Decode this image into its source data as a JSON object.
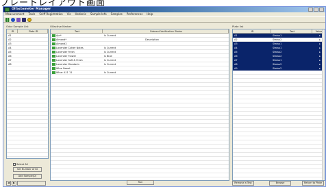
{
  "caption": "プレートレイアウト画面",
  "window": {
    "title": "Olfactometer Manager",
    "menus": [
      "Measurement",
      "Tools",
      "Sniff Registration",
      "Vis",
      "Hedonic",
      "Sample Info",
      "Samples",
      "Preferences",
      "Help"
    ]
  },
  "left_panel": {
    "label": "Odor Sample List",
    "columns": [
      "ID",
      "Plate ID"
    ],
    "rows": [
      [
        "A1",
        ""
      ],
      [
        "A2",
        ""
      ],
      [
        "A3",
        ""
      ],
      [
        "A4",
        ""
      ],
      [
        "A5",
        ""
      ],
      [
        "A6",
        ""
      ],
      [
        "A7",
        ""
      ],
      [
        "A8",
        ""
      ]
    ],
    "checkbox_label": "Select All",
    "btn_set_numbers": "Set Number of ID",
    "btn_add_sample": "Add Sample(D)"
  },
  "middle_panel": {
    "label": "Olfactive Marker",
    "columns": [
      "Test",
      "Odorant Verification Status"
    ],
    "rows": [
      {
        "name": "Apr*",
        "v1": "Is Current",
        "v2": ""
      },
      {
        "name": "Almond*",
        "v1": "",
        "v2": "Description"
      },
      {
        "name": "Almond2",
        "v1": "",
        "v2": ""
      },
      {
        "name": "Lavender Cutter Notes",
        "v1": "Is Current",
        "v2": ""
      },
      {
        "name": "Lavender Fresh",
        "v1": "Is Current",
        "v2": ""
      },
      {
        "name": "Lavender Flower",
        "v1": "Is Blue",
        "v2": ""
      },
      {
        "name": "Lavender Soft & Fresh",
        "v1": "Is Current",
        "v2": ""
      },
      {
        "name": "Lavender Mandarin",
        "v1": "Is Current",
        "v2": ""
      },
      {
        "name": "Wine Sweet",
        "v1": "",
        "v2": ""
      },
      {
        "name": "Wine: A11 11",
        "v1": "Is Current",
        "v2": ""
      }
    ]
  },
  "right_panel": {
    "label": "Plate list",
    "columns": [
      "ID",
      "Test",
      "Value"
    ],
    "rows": [
      {
        "id": "A1",
        "test": "Status1",
        "sel": true
      },
      {
        "id": "A2",
        "test": "Status2",
        "sel": false
      },
      {
        "id": "A3",
        "test": "Status1",
        "sel": true
      },
      {
        "id": "A4",
        "test": "Status1",
        "sel": true
      },
      {
        "id": "A5",
        "test": "Status2",
        "sel": true
      },
      {
        "id": "A6",
        "test": "Status2",
        "sel": true
      },
      {
        "id": "A7",
        "test": "Status1",
        "sel": true
      },
      {
        "id": "A8",
        "test": "Status2",
        "sel": true
      },
      {
        "id": "A9",
        "test": "Status2",
        "sel": true
      }
    ]
  },
  "bottom": {
    "btn_center": "Run",
    "btn_remove": "Remove a Test",
    "btn_browse": "Browse",
    "btn_return": "Return to Plate"
  }
}
